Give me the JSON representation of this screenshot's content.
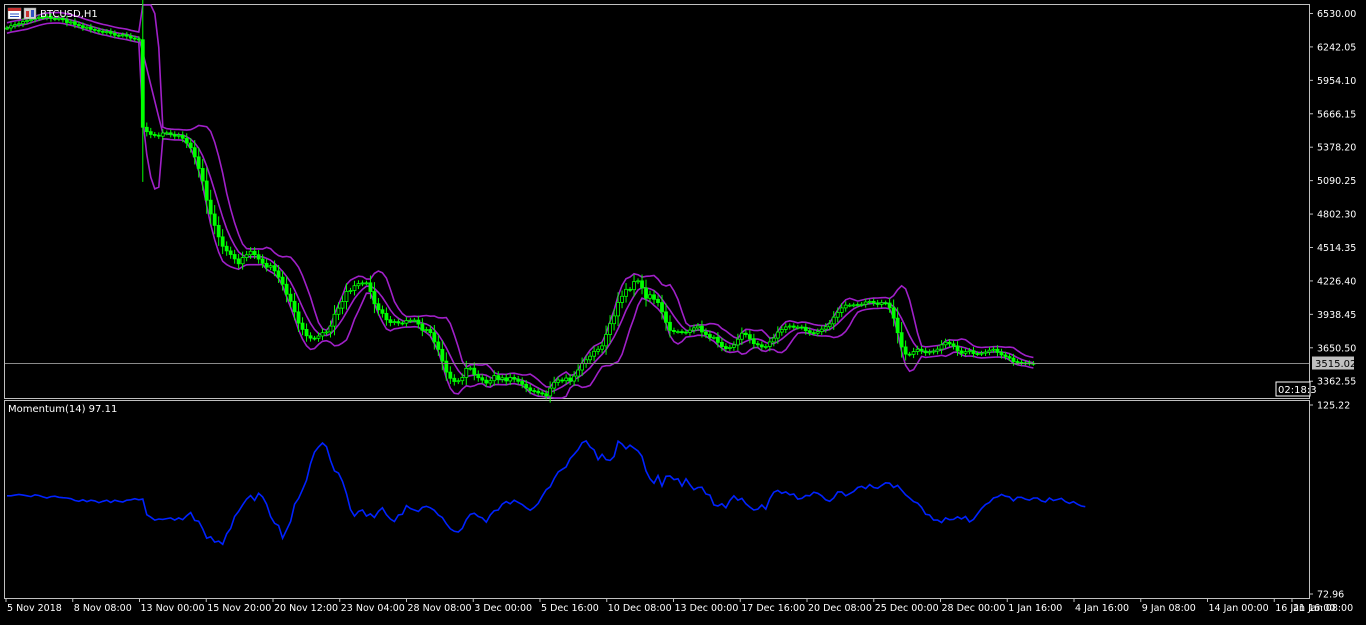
{
  "window": {
    "symbol_label": "BTCUSD,H1",
    "icon": "chart-window-icon",
    "timer": "02:18:3",
    "current_price": "3515.02"
  },
  "indicator": {
    "label": "Momentum(14) 97.11"
  },
  "colors": {
    "background": "#000000",
    "frame": "#c0c0c0",
    "candle": "#00ff00",
    "bollinger": "#a020c8",
    "momentum": "#0022ff",
    "price_line": "#8a8a8a"
  },
  "chart_data": [
    {
      "type": "candlestick",
      "title": "BTCUSD,H1",
      "ylim": [
        3218,
        6603
      ],
      "y_ticks": [
        "6530.00",
        "6242.05",
        "5954.10",
        "5666.15",
        "5378.20",
        "5090.25",
        "4802.30",
        "4514.35",
        "4226.40",
        "3938.45",
        "3650.50",
        "3362.55"
      ],
      "x_ticks": [
        "5 Nov 2018",
        "8 Nov 08:00",
        "13 Nov 00:00",
        "15 Nov 20:00",
        "20 Nov 12:00",
        "23 Nov 04:00",
        "28 Nov 08:00",
        "3 Dec 00:00",
        "5 Dec 16:00",
        "10 Dec 08:00",
        "13 Dec 00:00",
        "17 Dec 16:00",
        "20 Dec 08:00",
        "25 Dec 00:00",
        "28 Dec 00:00",
        "1 Jan 16:00",
        "4 Jan 16:00",
        "9 Jan 08:00",
        "14 Jan 00:00",
        "16 Jan 16:00",
        "21 Jan 08:00"
      ],
      "x": [
        0,
        4,
        8,
        12,
        16,
        20,
        24,
        28,
        32,
        36,
        40,
        44,
        48,
        52,
        56,
        60,
        64,
        68,
        72,
        76,
        80,
        84,
        88,
        92,
        96,
        100,
        104,
        108,
        112,
        116,
        120,
        124,
        128,
        132,
        136,
        140,
        144,
        148,
        152,
        156,
        160,
        164,
        168,
        172,
        176,
        180,
        184,
        188,
        192,
        196,
        200,
        204,
        208,
        212,
        216,
        220,
        224,
        228,
        232,
        236,
        240,
        244,
        248,
        252,
        256,
        260,
        264,
        268,
        272,
        276,
        280,
        284,
        288,
        292,
        296,
        300,
        304,
        308,
        312,
        316,
        320,
        324,
        328,
        332,
        336,
        340,
        344,
        348,
        352,
        356,
        360,
        364,
        368,
        372,
        376,
        380,
        384,
        388,
        392,
        396,
        400,
        404,
        408,
        412,
        416,
        420,
        424,
        428,
        432,
        436,
        440,
        444,
        448,
        452,
        456,
        460,
        464,
        468,
        472,
        476,
        480,
        484,
        488,
        492,
        496,
        500,
        504,
        508,
        512,
        516,
        520,
        524,
        528,
        532,
        536,
        540,
        544,
        548,
        552,
        556,
        560,
        564,
        568,
        572,
        576,
        580,
        584,
        588,
        592,
        596,
        600,
        604,
        608,
        612,
        616,
        620,
        624,
        628,
        632,
        636,
        640,
        644,
        648,
        652,
        656,
        660,
        664,
        668,
        672,
        676,
        680,
        684,
        688,
        692,
        696,
        700,
        704,
        708,
        712,
        716,
        720,
        724,
        728,
        732,
        736,
        740,
        744,
        748,
        752,
        756,
        760,
        764,
        768,
        772,
        776,
        780,
        784,
        788,
        792,
        796,
        800,
        804,
        808,
        812,
        816,
        820,
        824,
        828,
        832,
        836,
        840,
        844,
        848,
        852,
        856,
        860,
        864,
        868,
        872,
        876,
        880,
        884,
        888,
        892,
        896,
        900,
        904,
        908,
        912,
        916,
        920,
        924,
        928,
        932,
        936,
        940,
        944,
        948,
        952,
        956,
        960,
        964,
        968,
        972,
        976,
        980,
        984,
        988,
        992,
        996,
        1000,
        1004,
        1008,
        1012,
        1016,
        1020,
        1024,
        1028,
        1032,
        1036,
        1040,
        1044,
        1048,
        1052,
        1056,
        1060,
        1064,
        1068,
        1072,
        1076,
        1080,
        1084,
        1088,
        1092,
        1096,
        1100,
        1104,
        1108,
        1112,
        1116,
        1120,
        1124,
        1128,
        1132,
        1136,
        1140,
        1144,
        1148,
        1152,
        1156,
        1160,
        1164,
        1168,
        1172,
        1176,
        1180,
        1184,
        1188,
        1192,
        1196,
        1200,
        1204,
        1208,
        1212,
        1216,
        1220,
        1224,
        1228,
        1232,
        1236,
        1240,
        1244,
        1248,
        1252,
        1256,
        1260,
        1264,
        1268,
        1272,
        1276,
        1280,
        1284,
        1288,
        1292,
        1296
      ],
      "close": [
        6405,
        6424,
        6434,
        6442,
        6461,
        6469,
        6477,
        6488,
        6497,
        6495,
        6504,
        6487,
        6484,
        6488,
        6476,
        6452,
        6457,
        6435,
        6425,
        6408,
        6412,
        6393,
        6386,
        6377,
        6368,
        6374,
        6358,
        6343,
        6342,
        6346,
        6334,
        6318,
        6311,
        6304,
        5550,
        5512,
        5488,
        5482,
        5473,
        5500,
        5502,
        5488,
        5473,
        5481,
        5455,
        5414,
        5374,
        5295,
        5195,
        5087,
        4922,
        4803,
        4705,
        4606,
        4525,
        4485,
        4454,
        4416,
        4374,
        4428,
        4452,
        4482,
        4452,
        4415,
        4378,
        4345,
        4358,
        4313,
        4259,
        4198,
        4112,
        4051,
        3960,
        3863,
        3809,
        3754,
        3734,
        3732,
        3752,
        3781,
        3787,
        3837,
        3939,
        3992,
        4049,
        4136,
        4144,
        4185,
        4203,
        4209,
        4210,
        4135,
        4030,
        3978,
        3947,
        3892,
        3868,
        3876,
        3864,
        3862,
        3885,
        3888,
        3889,
        3855,
        3801,
        3808,
        3781,
        3701,
        3637,
        3536,
        3441,
        3388,
        3360,
        3367,
        3395,
        3473,
        3475,
        3421,
        3393,
        3372,
        3347,
        3367,
        3411,
        3378,
        3392,
        3365,
        3395,
        3380,
        3362,
        3336,
        3305,
        3282,
        3276,
        3262,
        3255,
        3236,
        3303,
        3353,
        3373,
        3367,
        3390,
        3364,
        3407,
        3459,
        3515,
        3547,
        3578,
        3620,
        3638,
        3667,
        3765,
        3858,
        3925,
        4041,
        4094,
        4154,
        4151,
        4221,
        4227,
        4166,
        4077,
        4107,
        4068,
        4040,
        3960,
        3870,
        3800,
        3790,
        3790,
        3786,
        3783,
        3803,
        3822,
        3837,
        3787,
        3765,
        3739,
        3741,
        3697,
        3661,
        3644,
        3654,
        3675,
        3724,
        3776,
        3764,
        3728,
        3686,
        3676,
        3658,
        3662,
        3701,
        3734,
        3786,
        3809,
        3830,
        3838,
        3827,
        3829,
        3826,
        3798,
        3781,
        3776,
        3790,
        3811,
        3832,
        3857,
        3914,
        3955,
        3994,
        4018,
        4018,
        4020,
        4023,
        4026,
        4045,
        4050,
        4037,
        4024,
        4038,
        4036,
        3995,
        3906,
        3781,
        3658,
        3596,
        3594,
        3618,
        3638,
        3623,
        3608,
        3615,
        3622,
        3639,
        3676,
        3698,
        3684,
        3665,
        3624,
        3603,
        3617,
        3625,
        3601,
        3600,
        3604,
        3614,
        3630,
        3638,
        3611,
        3589,
        3575,
        3562,
        3532,
        3525,
        3519,
        3521,
        3517,
        3515
      ]
    },
    {
      "type": "line",
      "title": "Momentum(14) 97.11",
      "ylim": [
        72.96,
        125.22
      ],
      "y_ticks": [
        "125.22",
        "72.96"
      ],
      "x": [
        0,
        4,
        8,
        12,
        16,
        20,
        24,
        28,
        32,
        36,
        40,
        44,
        48,
        52,
        56,
        60,
        64,
        68,
        72,
        76,
        80,
        84,
        88,
        92,
        96,
        100,
        104,
        108,
        112,
        116,
        120,
        124,
        128,
        132,
        136,
        140,
        144,
        148,
        152,
        156,
        160,
        164,
        168,
        172,
        176,
        180,
        184,
        188,
        192,
        196,
        200,
        204,
        208,
        212,
        216,
        220,
        224,
        228,
        232,
        236,
        240,
        244,
        248,
        252,
        256,
        260,
        264,
        268,
        272,
        276,
        280,
        284,
        288,
        292,
        296,
        300,
        304,
        308,
        312,
        316,
        320,
        324,
        328,
        332,
        336,
        340,
        344,
        348,
        352,
        356,
        360,
        364,
        368,
        372,
        376,
        380,
        384,
        388,
        392,
        396,
        400,
        404,
        408,
        412,
        416,
        420,
        424,
        428,
        432,
        436,
        440,
        444,
        448,
        452,
        456,
        460,
        464,
        468,
        472,
        476,
        480,
        484,
        488,
        492,
        496,
        500,
        504,
        508,
        512,
        516,
        520,
        524,
        528,
        532,
        536,
        540,
        544,
        548,
        552,
        556,
        560,
        564,
        568,
        572,
        576,
        580,
        584,
        588,
        592,
        596,
        600,
        604,
        608,
        612,
        616,
        620,
        624,
        628,
        632,
        636,
        640,
        644,
        648,
        652,
        656,
        660,
        664,
        668,
        672,
        676,
        680,
        684,
        688,
        692,
        696,
        700,
        704,
        708,
        712,
        716,
        720,
        724,
        728,
        732,
        736,
        740,
        744,
        748,
        752,
        756,
        760,
        764,
        768,
        772,
        776,
        780,
        784,
        788,
        792,
        796,
        800,
        804,
        808,
        812,
        816,
        820,
        824,
        828,
        832,
        836,
        840,
        844,
        848,
        852,
        856,
        860,
        864,
        868,
        872,
        876,
        880,
        884,
        888,
        892,
        896,
        900,
        904,
        908,
        912,
        916,
        920,
        924,
        928,
        932,
        936,
        940,
        944,
        948,
        952,
        956,
        960,
        964,
        968,
        972,
        976,
        980,
        984,
        988,
        992,
        996,
        1000,
        1004,
        1008,
        1012,
        1016,
        1020,
        1024,
        1028,
        1032,
        1036,
        1040,
        1044,
        1048,
        1052,
        1056,
        1060,
        1064,
        1068,
        1072,
        1076,
        1080,
        1084,
        1088,
        1092,
        1096,
        1100,
        1104,
        1108,
        1112,
        1116,
        1120,
        1124,
        1128,
        1132,
        1136,
        1140,
        1144,
        1148,
        1152,
        1156,
        1160,
        1164,
        1168,
        1172,
        1176,
        1180,
        1184,
        1188,
        1192,
        1196,
        1200,
        1204,
        1208,
        1212,
        1216,
        1220,
        1224,
        1228,
        1232,
        1236,
        1240,
        1244,
        1248,
        1252,
        1256,
        1260,
        1264,
        1268,
        1272,
        1276,
        1280,
        1284,
        1288,
        1292,
        1296
      ],
      "values": [
        100.1,
        100.1,
        100.3,
        100.5,
        100.3,
        100.1,
        99.9,
        100.4,
        100.2,
        99.8,
        99.5,
        99.9,
        100.0,
        99.7,
        99.6,
        99.5,
        99.3,
        98.8,
        98.6,
        99.0,
        98.5,
        98.9,
        98.7,
        98.2,
        98.6,
        98.9,
        98.3,
        98.9,
        98.6,
        98.4,
        98.9,
        99.0,
        99.3,
        99.0,
        99.2,
        94.9,
        94.2,
        93.4,
        93.7,
        93.6,
        93.8,
        94.0,
        93.4,
        94.0,
        93.5,
        94.6,
        95.5,
        93.3,
        93.1,
        91.0,
        88.4,
        88.8,
        87.3,
        87.6,
        86.7,
        89.6,
        91.1,
        94.4,
        95.8,
        97.6,
        99.2,
        100.2,
        98.8,
        100.8,
        99.8,
        97.8,
        94.4,
        92.5,
        91.9,
        88.4,
        90.7,
        93.0,
        97.8,
        99.4,
        101.8,
        104.4,
        109.0,
        112.2,
        113.6,
        114.7,
        113.7,
        109.9,
        107.0,
        106.4,
        104.1,
        100.7,
        96.3,
        94.5,
        95.8,
        96.2,
        94.5,
        95.1,
        94.1,
        95.8,
        96.8,
        94.9,
        93.7,
        93.0,
        94.8,
        95.0,
        97.4,
        96.6,
        96.2,
        95.8,
        96.9,
        97.2,
        96.8,
        96.1,
        94.8,
        94.1,
        92.4,
        91.0,
        90.3,
        90.1,
        91.1,
        93.5,
        95.0,
        95.3,
        94.4,
        94.0,
        92.8,
        94.8,
        96.0,
        96.2,
        97.8,
        98.5,
        97.9,
        98.9,
        98.3,
        97.7,
        96.8,
        96.1,
        96.9,
        98.0,
        100.0,
        101.8,
        102.6,
        104.9,
        106.7,
        107.4,
        108.1,
        110.4,
        111.6,
        112.9,
        114.8,
        115.3,
        113.6,
        112.8,
        110.1,
        111.6,
        110.1,
        109.9,
        111.0,
        115.2,
        114.4,
        113.1,
        114.1,
        113.3,
        112.5,
        111.0,
        107.0,
        104.8,
        103.6,
        105.7,
        102.8,
        105.5,
        105.6,
        104.6,
        104.8,
        102.8,
        104.8,
        103.2,
        101.8,
        102.4,
        102.5,
        100.6,
        100.3,
        97.6,
        97.3,
        97.9,
        96.8,
        98.8,
        100.1,
        98.9,
        99.4,
        97.9,
        97.0,
        96.2,
        96.4,
        97.6,
        96.4,
        99.3,
        101.1,
        101.6,
        100.8,
        101.2,
        100.4,
        100.6,
        99.2,
        99.4,
        100.2,
        100.1,
        101.1,
        100.8,
        100.1,
        99.0,
        98.6,
        99.5,
        101.2,
        101.2,
        100.1,
        100.7,
        101.3,
        102.4,
        102.7,
        102.1,
        103.2,
        102.4,
        102.2,
        103.0,
        103.7,
        103.6,
        102.4,
        103.0,
        101.7,
        100.4,
        99.5,
        98.5,
        98.1,
        96.9,
        95.0,
        94.8,
        93.4,
        93.4,
        92.7,
        94.0,
        93.5,
        93.6,
        94.3,
        93.7,
        94.4,
        92.9,
        93.6,
        95.1,
        96.6,
        97.7,
        98.3,
        99.5,
        99.8,
        100.5,
        100.0,
        99.8,
        98.7,
        99.7,
        99.7,
        99.2,
        98.9,
        99.5,
        99.5,
        98.7,
        98.4,
        99.5,
        98.8,
        99.1,
        99.4,
        98.5,
        98.0,
        98.5,
        97.8,
        97.3,
        97.1
      ]
    }
  ]
}
